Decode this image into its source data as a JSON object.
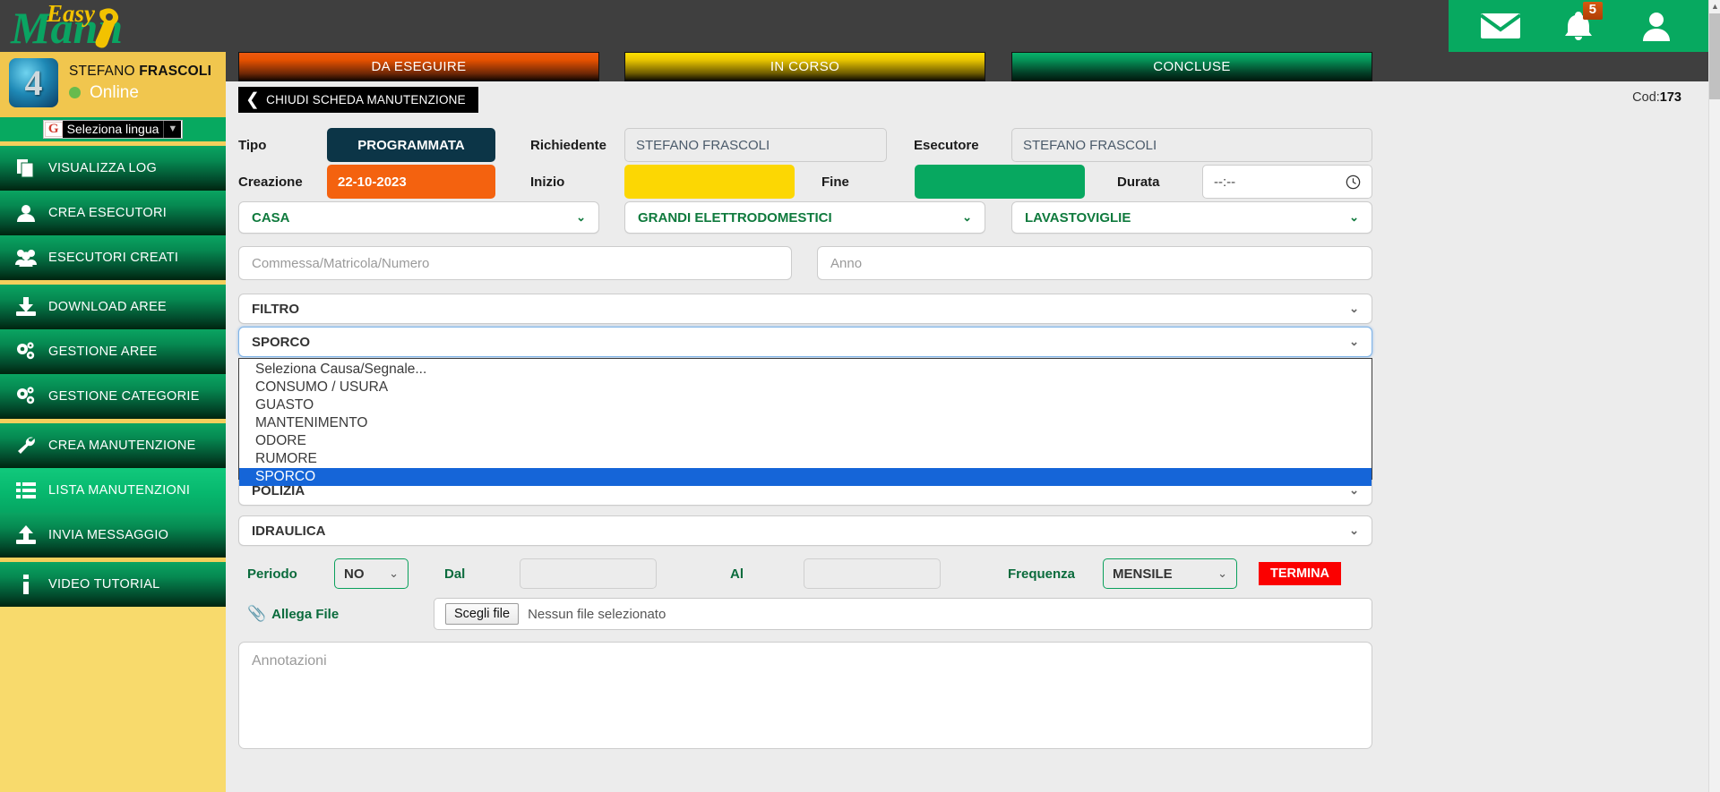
{
  "brand": {
    "name": "EasyMann",
    "word_top": "Easy",
    "word_main": "Mann"
  },
  "header": {
    "mail_icon": "envelope-icon",
    "bell_icon": "bell-icon",
    "notification_count": "5",
    "user_icon": "user-avatar-icon"
  },
  "sidebar": {
    "user": {
      "first_name": "STEFANO",
      "last_name": "FRASCOLI",
      "status": "Online"
    },
    "language": {
      "label": "Seleziona lingua",
      "arrow": "▼"
    },
    "items": [
      {
        "label": "VISUALIZZA LOG",
        "icon": "copy-document-icon",
        "active": false
      },
      {
        "label": "CREA ESECUTORI",
        "icon": "user-icon",
        "active": false
      },
      {
        "label": "ESECUTORI CREATI",
        "icon": "users-group-icon",
        "active": false
      },
      {
        "label": "DOWNLOAD AREE",
        "icon": "download-icon",
        "active": false
      },
      {
        "label": "GESTIONE AREE",
        "icon": "gears-icon",
        "active": false
      },
      {
        "label": "GESTIONE CATEGORIE",
        "icon": "gears-icon",
        "active": false
      },
      {
        "label": "CREA MANUTENZIONE",
        "icon": "wrench-icon",
        "active": false
      },
      {
        "label": "LISTA MANUTENZIONI",
        "icon": "list-icon",
        "active": true
      },
      {
        "label": "INVIA MESSAGGIO",
        "icon": "upload-icon",
        "active": false
      },
      {
        "label": "VIDEO TUTORIAL",
        "icon": "info-icon",
        "active": false
      }
    ]
  },
  "tabs": [
    {
      "label": "DA ESEGUIRE",
      "color": "#e65100"
    },
    {
      "label": "IN CORSO",
      "color": "#e8c400"
    },
    {
      "label": "CONCLUSE",
      "color": "#059257"
    }
  ],
  "form": {
    "code_label": "Cod:",
    "code_value": "173",
    "close_button": "CHIUDI SCHEDA MANUTENZIONE",
    "close_chevron": "❮",
    "tipo_label": "Tipo",
    "tipo_value": "PROGRAMMATA",
    "richiedente_label": "Richiedente",
    "richiedente_value": "STEFANO FRASCOLI",
    "esecutore_label": "Esecutore",
    "esecutore_value": "STEFANO FRASCOLI",
    "creazione_label": "Creazione",
    "creazione_value": "22-10-2023",
    "inizio_label": "Inizio",
    "inizio_value": "",
    "fine_label": "Fine",
    "fine_value": "",
    "durata_label": "Durata",
    "durata_value": "--:--",
    "durata_icon": "clock-icon",
    "area_value": "CASA",
    "categoria_value": "GRANDI ELETTRODOMESTICI",
    "sottocategoria_value": "LAVASTOVIGLIE",
    "commessa_placeholder": "Commessa/Matricola/Numero",
    "anno_placeholder": "Anno",
    "filtro_value": "FILTRO",
    "causa_value": "SPORCO",
    "hidden_value": "POLIZIA",
    "idraulica_value": "IDRAULICA",
    "chevron": "⌄"
  },
  "causa_dropdown": {
    "open": true,
    "options": [
      {
        "label": "Seleziona Causa/Segnale...",
        "selected": false
      },
      {
        "label": "CONSUMO / USURA",
        "selected": false
      },
      {
        "label": "GUASTO",
        "selected": false
      },
      {
        "label": "MANTENIMENTO",
        "selected": false
      },
      {
        "label": "ODORE",
        "selected": false
      },
      {
        "label": "RUMORE",
        "selected": false
      },
      {
        "label": "SPORCO",
        "selected": true
      }
    ]
  },
  "periodo": {
    "label": "Periodo",
    "value": "NO",
    "dal_label": "Dal",
    "dal_value": "",
    "al_label": "Al",
    "al_value": "",
    "frequenza_label": "Frequenza",
    "frequenza_value": "MENSILE",
    "termina_label": "TERMINA"
  },
  "attachment": {
    "label": "Allega File",
    "icon": "paperclip-icon",
    "button_label": "Scegli file",
    "status": "Nessun file selezionato"
  },
  "notes": {
    "placeholder": "Annotazioni",
    "value": ""
  },
  "scrollbar": {
    "up": "▲",
    "down": "▼"
  },
  "colors": {
    "brand_green": "#07a960",
    "accent_yellow": "#f8da6c",
    "danger": "#fb0000",
    "dark": "#3f3f3f"
  }
}
